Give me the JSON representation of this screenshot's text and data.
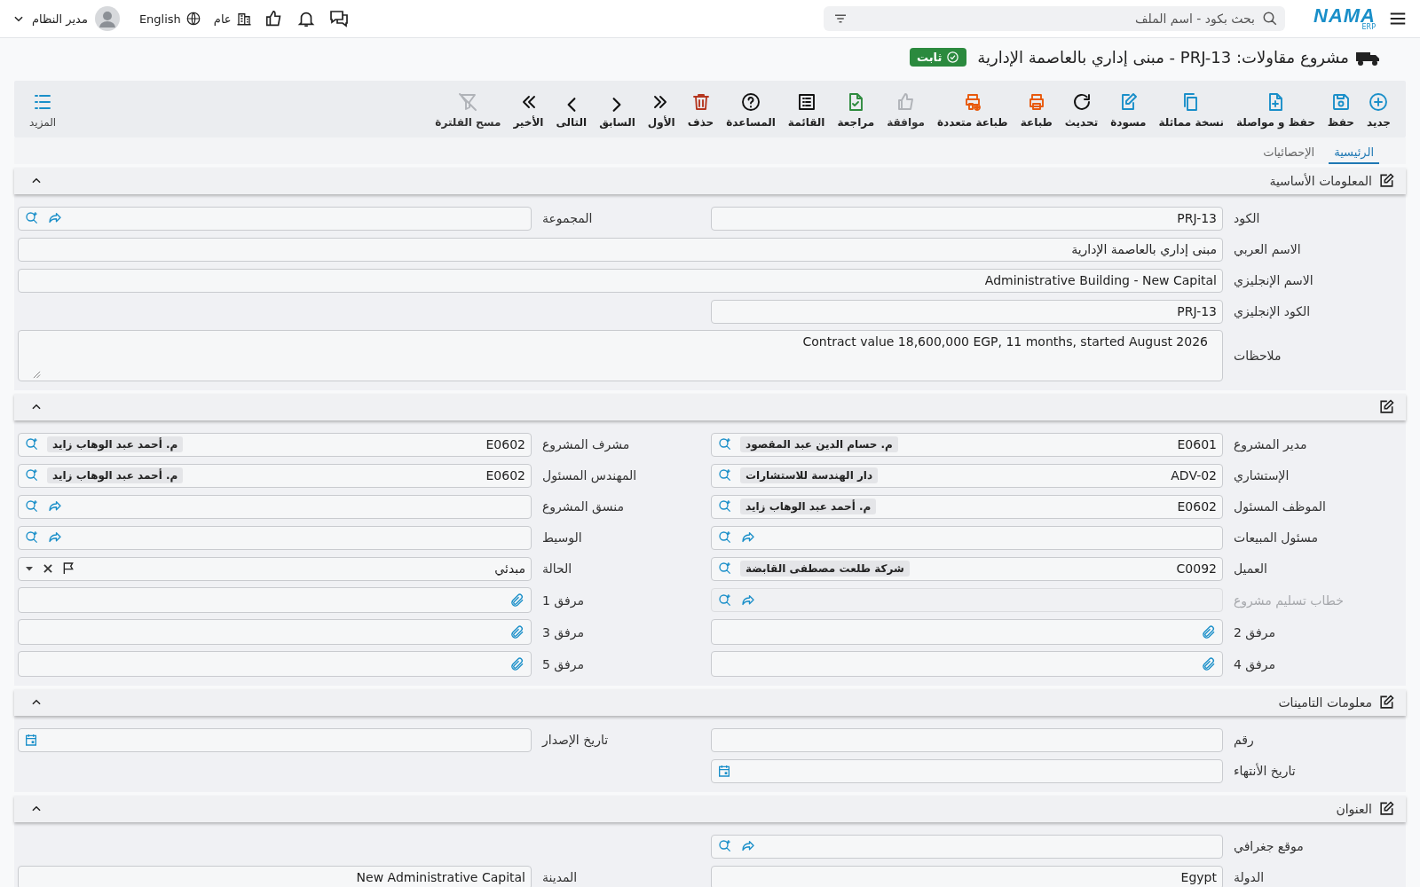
{
  "topbar": {
    "logo": {
      "text": "NAMA",
      "sub": "ERP"
    },
    "search": {
      "placeholder": "بحث بكود - اسم الملف"
    },
    "branch": "عام",
    "language": "English",
    "user": "مدير النظام"
  },
  "page": {
    "title": "مشروع مقاولات: PRJ-13 - مبنى إداري بالعاصمة الإدارية",
    "status": "ثابت"
  },
  "toolbar": {
    "actions": [
      {
        "kind": "new",
        "label": "جديد",
        "disabled": false
      },
      {
        "kind": "save",
        "label": "حفظ",
        "disabled": false
      },
      {
        "kind": "save_continue",
        "label": "حفظ و مواصلة",
        "disabled": false
      },
      {
        "kind": "copy",
        "label": "نسخة مماثلة",
        "disabled": false
      },
      {
        "kind": "draft",
        "label": "مسودة",
        "disabled": false
      },
      {
        "kind": "refresh",
        "label": "تحديث",
        "disabled": false
      },
      {
        "kind": "print",
        "label": "طباعة",
        "disabled": false
      },
      {
        "kind": "multi_print",
        "label": "طباعة متعددة",
        "disabled": false
      },
      {
        "kind": "approve",
        "label": "موافقة",
        "disabled": true
      },
      {
        "kind": "review",
        "label": "مراجعة",
        "disabled": false
      },
      {
        "kind": "list",
        "label": "القائمة",
        "disabled": false
      },
      {
        "kind": "help",
        "label": "المساعدة",
        "disabled": false
      },
      {
        "kind": "delete",
        "label": "حذف",
        "disabled": false
      },
      {
        "kind": "first",
        "label": "الأول",
        "disabled": false
      },
      {
        "kind": "prev",
        "label": "السابق",
        "disabled": false
      },
      {
        "kind": "next",
        "label": "التالى",
        "disabled": false
      },
      {
        "kind": "last",
        "label": "الأخير",
        "disabled": false
      },
      {
        "kind": "clear_filter",
        "label": "مسح الفلترة",
        "disabled": true
      }
    ],
    "more": "المزيد"
  },
  "tabs": [
    {
      "label": "الرئيسية",
      "selected": true
    },
    {
      "label": "الإحصائيات",
      "selected": false
    }
  ],
  "sections": [
    {
      "title": "المعلومات الأساسية",
      "expanded": true,
      "rows": [
        [
          {
            "label": "الكود",
            "kind": "text",
            "value": "PRJ-13",
            "disabled": false
          },
          {
            "label": "المجموعة",
            "kind": "lookup",
            "disabled": false
          }
        ],
        [
          {
            "label": "الاسم العربي",
            "kind": "text",
            "value": "مبنى إداري بالعاصمة الإدارية",
            "wide": true,
            "disabled": false
          }
        ],
        [
          {
            "label": "الاسم الإنجليزي",
            "kind": "text",
            "value": "Administrative Building - New Capital",
            "wide": true,
            "disabled": false
          }
        ],
        [
          {
            "label": "الكود الإنجليزي",
            "kind": "text",
            "value": "PRJ-13",
            "disabled": false
          }
        ],
        [
          {
            "label": "ملاحظات",
            "kind": "textarea",
            "value": "Contract value 18,600,000 EGP, 11 months, started August 2026",
            "wide": true,
            "disabled": false
          }
        ]
      ]
    },
    {
      "expanded": true,
      "rows": [
        [
          {
            "label": "مدير المشروع",
            "kind": "lookup",
            "value": "E0601",
            "name": "م. حسام الدين عبد المقصود",
            "disabled": false
          },
          {
            "label": "مشرف المشروع",
            "kind": "lookup",
            "value": "E0602",
            "name": "م. أحمد عبد الوهاب زايد",
            "disabled": false
          }
        ],
        [
          {
            "label": "الإستشاري",
            "kind": "lookup",
            "value": "ADV-02",
            "name": "دار الهندسة للاستشارات",
            "disabled": false
          },
          {
            "label": "المهندس المسئول",
            "kind": "lookup",
            "value": "E0602",
            "name": "م. أحمد عبد الوهاب زايد",
            "disabled": false
          }
        ],
        [
          {
            "label": "الموظف المسئول",
            "kind": "lookup",
            "value": "E0602",
            "name": "م. أحمد عبد الوهاب زايد",
            "disabled": false
          },
          {
            "label": "منسق المشروع",
            "kind": "lookup",
            "disabled": false
          }
        ],
        [
          {
            "label": "مسئول المبيعات",
            "kind": "lookup",
            "disabled": false
          },
          {
            "label": "الوسيط",
            "kind": "lookup",
            "disabled": false
          }
        ],
        [
          {
            "label": "العميل",
            "kind": "lookup",
            "value": "C0092",
            "name": "شركة طلعت مصطفى القابضة",
            "disabled": false
          },
          {
            "label": "الحالة",
            "kind": "select",
            "value": "مبدئي",
            "disabled": false
          }
        ],
        [
          {
            "label": "خطاب تسليم مشروع",
            "kind": "lookup",
            "disabled": true
          },
          {
            "label": "مرفق 1",
            "kind": "attachment",
            "disabled": false
          }
        ],
        [
          {
            "label": "مرفق 2",
            "kind": "attachment",
            "disabled": false
          },
          {
            "label": "مرفق 3",
            "kind": "attachment",
            "disabled": false
          }
        ],
        [
          {
            "label": "مرفق 4",
            "kind": "attachment",
            "disabled": false
          },
          {
            "label": "مرفق 5",
            "kind": "attachment",
            "disabled": false
          }
        ]
      ]
    },
    {
      "title": "معلومات التامينات",
      "expanded": true,
      "rows": [
        [
          {
            "label": "رقم",
            "kind": "text",
            "disabled": false
          },
          {
            "label": "تاريخ الإصدار",
            "kind": "date",
            "disabled": false
          }
        ],
        [
          {
            "label": "تاريخ الأنتهاء",
            "kind": "date",
            "disabled": false
          }
        ]
      ]
    },
    {
      "title": "العنوان",
      "expanded": true,
      "rows": [
        [
          {
            "label": "موقع جغرافي",
            "kind": "lookup",
            "disabled": false
          }
        ],
        [
          {
            "label": "الدولة",
            "kind": "text",
            "value": "Egypt",
            "disabled": false
          },
          {
            "label": "المدينة",
            "kind": "text",
            "value": "New Administrative Capital",
            "disabled": false
          }
        ]
      ]
    }
  ]
}
